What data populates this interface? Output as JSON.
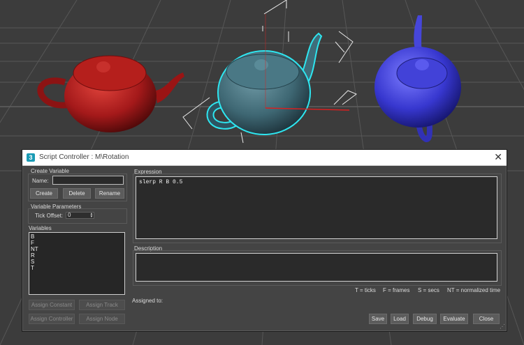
{
  "window": {
    "title": "Script Controller : M\\Rotation",
    "app_icon": "3",
    "close_glyph": "✕"
  },
  "create_variable": {
    "title": "Create Variable",
    "name_label": "Name:",
    "name_value": "",
    "create_label": "Create",
    "delete_label": "Delete",
    "rename_label": "Rename"
  },
  "variable_parameters": {
    "title": "Variable Parameters",
    "tick_offset_label": "Tick Offset:",
    "tick_offset_value": "0"
  },
  "variables": {
    "title": "Variables",
    "items": [
      "B",
      "F",
      "NT",
      "R",
      "S",
      "T"
    ]
  },
  "assign": {
    "constant_label": "Assign Constant",
    "track_label": "Assign Track",
    "controller_label": "Assign Controller",
    "node_label": "Assign Node"
  },
  "expression": {
    "title": "Expression",
    "value": "slerp R B 0.5"
  },
  "description": {
    "title": "Description",
    "value": ""
  },
  "legend": {
    "ticks": "T = ticks",
    "frames": "F = frames",
    "secs": "S = secs",
    "normalized": "NT = normalized time"
  },
  "assigned_to_label": "Assigned to:",
  "buttons": {
    "save": "Save",
    "load": "Load",
    "debug": "Debug",
    "evaluate": "Evaluate",
    "close": "Close"
  },
  "scene": {
    "teapots": [
      {
        "color": "#b81d1a",
        "selected": false
      },
      {
        "color": "#3f6d7a",
        "selected": true,
        "selection_color": "#2ee6f0"
      },
      {
        "color": "#3b3bd2",
        "selected": false
      }
    ],
    "grid_color": "#5a5a5a",
    "background": "#3c3c3c"
  }
}
